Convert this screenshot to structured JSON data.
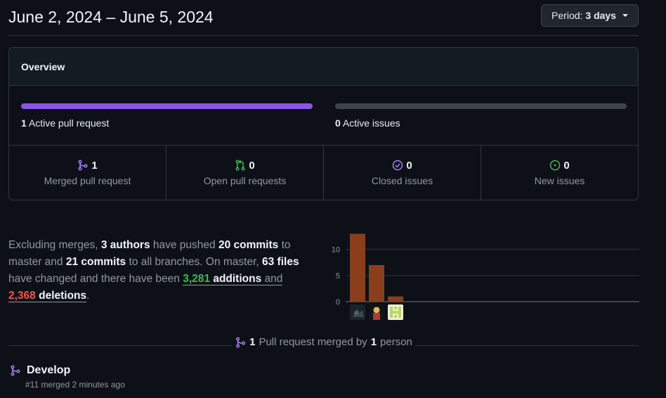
{
  "header": {
    "title": "June 2, 2024 – June 5, 2024",
    "period_label": "Period:",
    "period_value": "3 days"
  },
  "overview": {
    "heading": "Overview",
    "active_prs": {
      "count": "1",
      "label": "Active pull request",
      "fill_fraction": 1.0
    },
    "active_issues": {
      "count": "0",
      "label": "Active issues",
      "fill_fraction": 0.0
    },
    "stats": [
      {
        "value": "1",
        "label": "Merged pull request",
        "icon": "git-merge-icon",
        "color": "#ab7df8"
      },
      {
        "value": "0",
        "label": "Open pull requests",
        "icon": "git-pull-request-icon",
        "color": "#3fb950"
      },
      {
        "value": "0",
        "label": "Closed issues",
        "icon": "issue-closed-icon",
        "color": "#ab7df8"
      },
      {
        "value": "0",
        "label": "New issues",
        "icon": "issue-opened-icon",
        "color": "#3fb950"
      }
    ]
  },
  "summary": {
    "t1": "Excluding merges, ",
    "authors": "3 authors",
    "t2": " have pushed ",
    "commits_master": "20 commits",
    "t3": " to master and ",
    "commits_all": "21 commits",
    "t4": " to all branches. On master, ",
    "files": "63 files",
    "t5": " have changed and there have been ",
    "additions_num": "3,281",
    "additions_word": " additions",
    "t6": " and",
    "deletions_num": "2,368",
    "deletions_word": " deletions",
    "t7": "."
  },
  "chart_data": {
    "type": "bar",
    "categories": [
      "author-1",
      "author-2",
      "author-3"
    ],
    "values": [
      13,
      7,
      1
    ],
    "yticks": [
      "0",
      "5",
      "10"
    ],
    "ylim": [
      0,
      14
    ],
    "bar_color": "#8b3e1b",
    "grid": true
  },
  "merged": {
    "count": "1",
    "text": "Pull request merged by",
    "people": "1",
    "people_word": "person"
  },
  "pr": {
    "title": "Develop",
    "meta": "#11 merged 2 minutes ago"
  }
}
